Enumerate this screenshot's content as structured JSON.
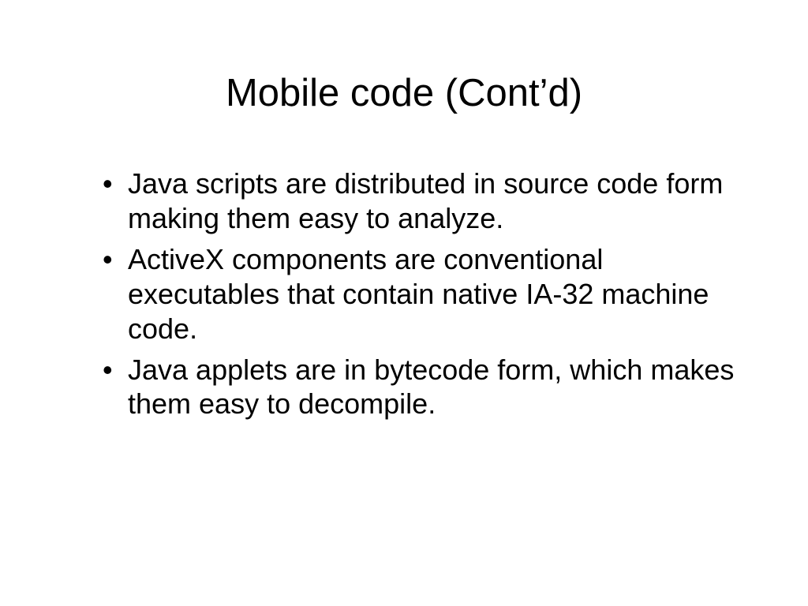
{
  "slide": {
    "title": "Mobile code (Cont’d)",
    "bullets": [
      "Java scripts are distributed in source code form making them easy to analyze.",
      "ActiveX components are conventional executables that contain native IA-32 machine code.",
      "Java applets are in bytecode form, which makes them easy to decompile."
    ]
  }
}
